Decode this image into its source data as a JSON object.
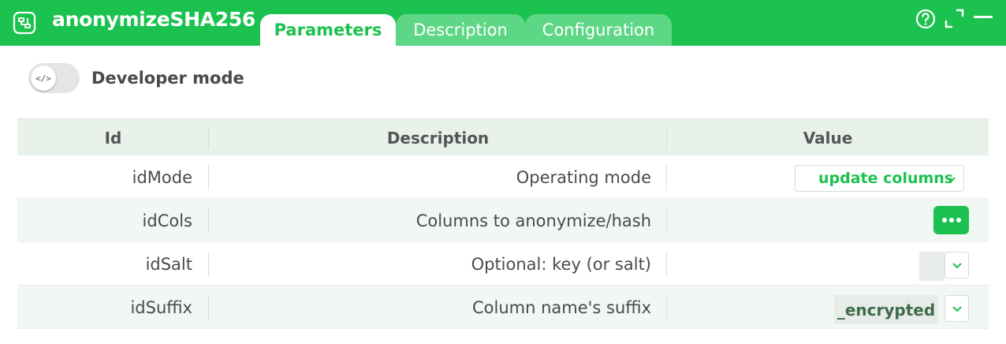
{
  "app": {
    "title": "anonymizeSHA256",
    "icon": "node-icon"
  },
  "tabs": [
    {
      "label": "Parameters",
      "active": true
    },
    {
      "label": "Description",
      "active": false
    },
    {
      "label": "Configuration",
      "active": false
    }
  ],
  "window_controls": [
    "help-icon",
    "expand-icon",
    "minimize-icon"
  ],
  "developer_mode": {
    "label": "Developer mode",
    "knob_glyph": "</>",
    "enabled": false
  },
  "table": {
    "headers": {
      "id": "Id",
      "description": "Description",
      "value": "Value"
    },
    "rows": [
      {
        "id": "idMode",
        "description": "Operating mode",
        "value": "update columns",
        "widget": "select"
      },
      {
        "id": "idCols",
        "description": "Columns to anonymize/hash",
        "value": "",
        "widget": "button"
      },
      {
        "id": "idSalt",
        "description": "Optional: key (or salt)",
        "value": "",
        "widget": "input"
      },
      {
        "id": "idSuffix",
        "description": "Column name's suffix",
        "value": "_encrypted",
        "widget": "input"
      }
    ]
  },
  "colors": {
    "accent": "#1cc24f",
    "tab_inactive": "#5dd785",
    "header_bg": "#e8f1ea",
    "row_alt": "#f1f7f2"
  }
}
